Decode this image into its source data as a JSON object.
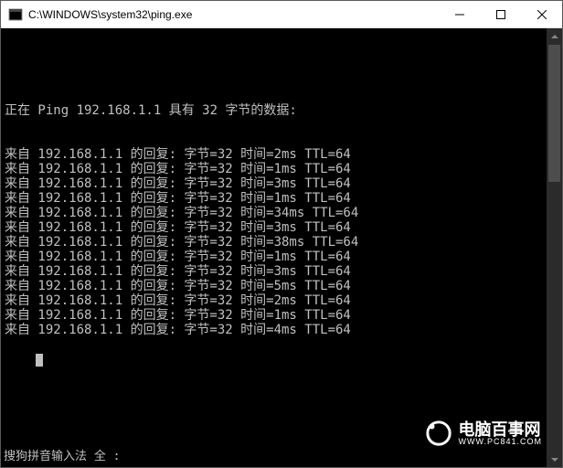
{
  "title": "C:\\WINDOWS\\system32\\ping.exe",
  "header_line": "正在 Ping 192.168.1.1 具有 32 字节的数据:",
  "replies": [
    {
      "ip": "192.168.1.1",
      "bytes": 32,
      "time": "2ms",
      "ttl": 64
    },
    {
      "ip": "192.168.1.1",
      "bytes": 32,
      "time": "1ms",
      "ttl": 64
    },
    {
      "ip": "192.168.1.1",
      "bytes": 32,
      "time": "3ms",
      "ttl": 64
    },
    {
      "ip": "192.168.1.1",
      "bytes": 32,
      "time": "1ms",
      "ttl": 64
    },
    {
      "ip": "192.168.1.1",
      "bytes": 32,
      "time": "34ms",
      "ttl": 64
    },
    {
      "ip": "192.168.1.1",
      "bytes": 32,
      "time": "3ms",
      "ttl": 64
    },
    {
      "ip": "192.168.1.1",
      "bytes": 32,
      "time": "38ms",
      "ttl": 64
    },
    {
      "ip": "192.168.1.1",
      "bytes": 32,
      "time": "1ms",
      "ttl": 64
    },
    {
      "ip": "192.168.1.1",
      "bytes": 32,
      "time": "3ms",
      "ttl": 64
    },
    {
      "ip": "192.168.1.1",
      "bytes": 32,
      "time": "5ms",
      "ttl": 64
    },
    {
      "ip": "192.168.1.1",
      "bytes": 32,
      "time": "2ms",
      "ttl": 64
    },
    {
      "ip": "192.168.1.1",
      "bytes": 32,
      "time": "1ms",
      "ttl": 64
    },
    {
      "ip": "192.168.1.1",
      "bytes": 32,
      "time": "4ms",
      "ttl": 64
    }
  ],
  "reply_template": {
    "prefix": "来自 ",
    "mid1": " 的回复: 字节=",
    "mid2": " 时间=",
    "mid3": " TTL="
  },
  "ime_text": "搜狗拼音输入法 全 :",
  "watermark": {
    "cn": "电脑百事网",
    "url": "WWW.PC841.COM"
  }
}
